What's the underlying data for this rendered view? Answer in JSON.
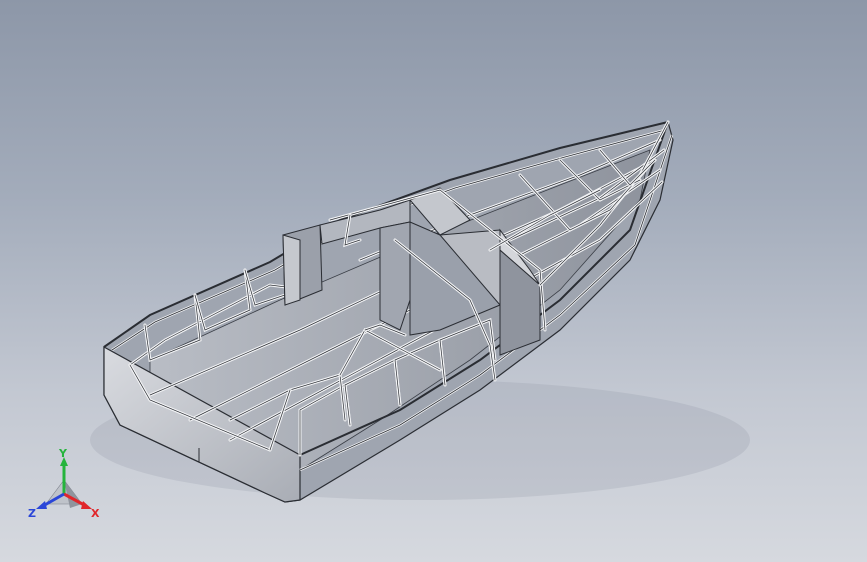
{
  "viewport": {
    "model_name": "boat-hull-frame",
    "background_top": "#8d97a8",
    "background_bottom": "#d6d9df"
  },
  "triad": {
    "x_label": "X",
    "y_label": "Y",
    "z_label": "Z",
    "x_color": "#e0262b",
    "y_color": "#25b43c",
    "z_color": "#2a46d8"
  }
}
